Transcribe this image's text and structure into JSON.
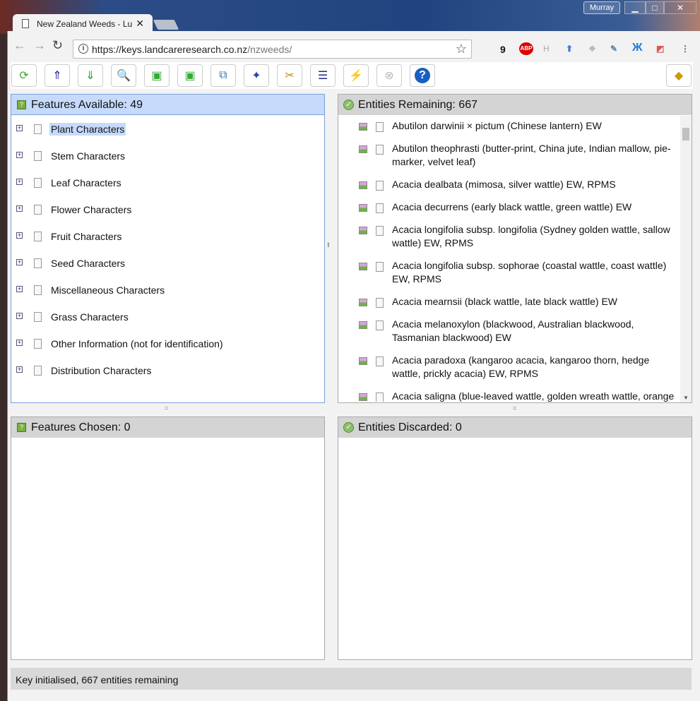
{
  "browser": {
    "tab_title": "New Zealand Weeds - Lu",
    "url_host": "https://keys.landcareresearch.co.nz",
    "url_path": "/nzweeds/",
    "profile": "Murray",
    "ext_badge": "9",
    "ext_abp": "ABP",
    "ext_h": "H"
  },
  "toolbar": {
    "buttons": [
      "restart-icon",
      "features-up-icon",
      "features-down-icon",
      "find-feature-icon",
      "best-feature-icon",
      "identify-image-icon",
      "differences-icon",
      "wizard-icon",
      "cut-icon",
      "checklist-icon",
      "lightning-check-icon",
      "discard-help-icon",
      "help-icon"
    ],
    "logo": "lucid-logo"
  },
  "features_available": {
    "title": "Features Available: 49",
    "items": [
      "Plant Characters",
      "Stem Characters",
      "Leaf Characters",
      "Flower Characters",
      "Fruit Characters",
      "Seed Characters",
      "Miscellaneous Characters",
      "Grass Characters",
      "Other Information (not for identification)",
      "Distribution Characters"
    ],
    "selected": 0
  },
  "entities_remaining": {
    "title": "Entities Remaining: 667",
    "items": [
      "Abutilon darwinii × pictum (Chinese lantern) EW",
      "Abutilon theophrasti (butter-print, China jute, Indian mallow, pie-marker, velvet leaf)",
      "Acacia dealbata (mimosa, silver wattle) EW, RPMS",
      "Acacia decurrens (early black wattle, green wattle) EW",
      "Acacia longifolia subsp. longifolia (Sydney golden wattle, sallow wattle) EW, RPMS",
      "Acacia longifolia subsp. sophorae (coastal wattle, coast wattle) EW, RPMS",
      "Acacia mearnsii (black wattle, late black wattle) EW",
      "Acacia melanoxylon (blackwood, Australian blackwood, Tasmanian blackwood) EW",
      "Acacia paradoxa (kangaroo acacia, kangaroo thorn, hedge wattle, prickly acacia) EW, RPMS",
      "Acacia saligna (blue-leaved wattle, golden wreath wattle, orange wattle) RPMS"
    ]
  },
  "features_chosen": {
    "title": "Features Chosen: 0"
  },
  "entities_discarded": {
    "title": "Entities Discarded: 0"
  },
  "status": "Key initialised, 667 entities remaining"
}
